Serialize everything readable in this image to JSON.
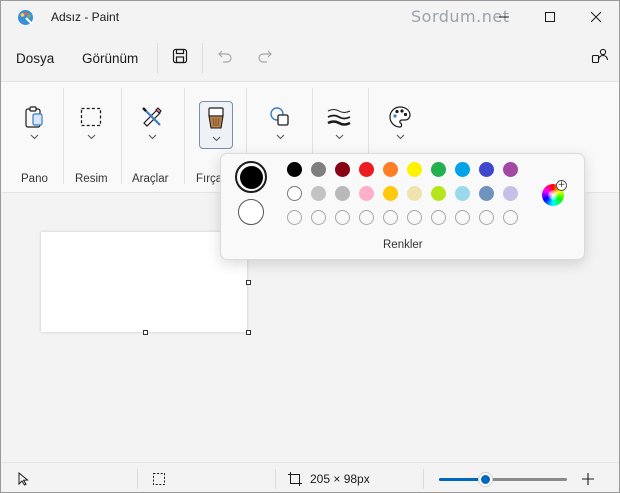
{
  "window": {
    "title": "Adsız - Paint",
    "watermark": "Sordum.net"
  },
  "menu": {
    "file_label": "Dosya",
    "view_label": "Görünüm"
  },
  "ribbon": {
    "groups": [
      {
        "label": "Pano",
        "icon": "clipboard-icon"
      },
      {
        "label": "Resim",
        "icon": "selection-icon"
      },
      {
        "label": "Araçlar",
        "icon": "tools-icon"
      },
      {
        "label": "Fırça",
        "icon": "brush-icon"
      },
      {
        "label": "",
        "icon": "shapes-icon"
      },
      {
        "label": "",
        "icon": "stroke-size-icon"
      },
      {
        "label": "",
        "icon": "palette-icon"
      }
    ]
  },
  "colors": {
    "label": "Renkler",
    "primary": "#000000",
    "secondary": "#ffffff",
    "row1": [
      "#000000",
      "#7f7f7f",
      "#880015",
      "#ed1c24",
      "#ff7f27",
      "#fff200",
      "#22b14c",
      "#00a2e8",
      "#3f48cc",
      "#a349a4"
    ],
    "row2": [
      "#ffffff",
      "#c3c3c3",
      "#b9b9b9",
      "#ffaec9",
      "#ffc90e",
      "#efe4b0",
      "#b5e61d",
      "#99d9ea",
      "#7092be",
      "#c8bfe7"
    ],
    "row3_empty": 10
  },
  "status": {
    "canvas_size": "205 × 98px",
    "zoom_fraction": 0.37
  }
}
